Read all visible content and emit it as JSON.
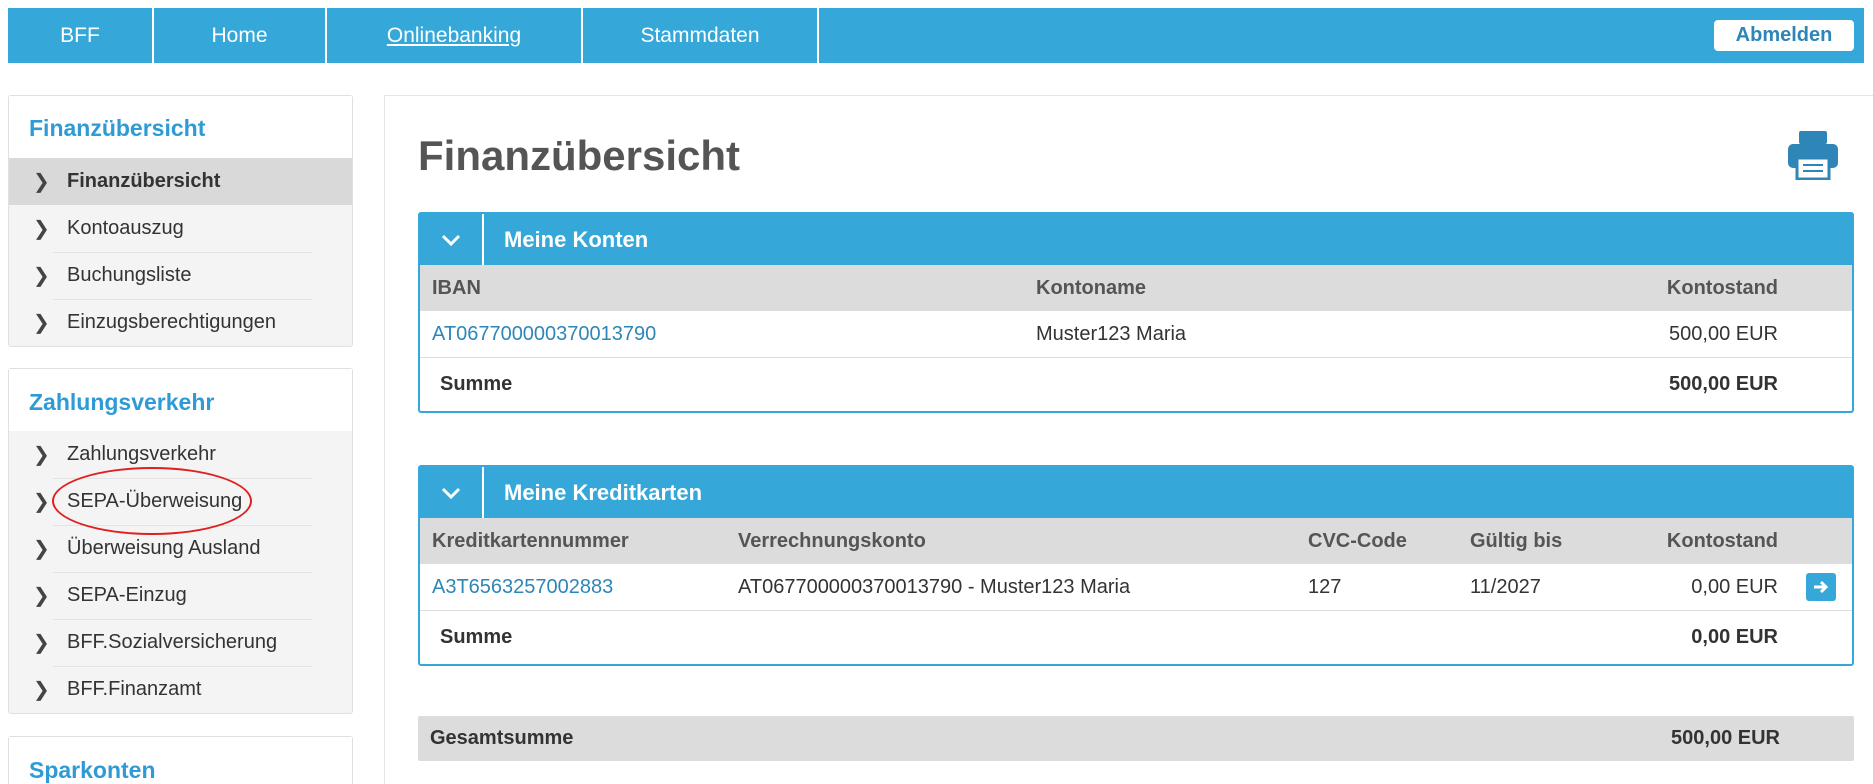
{
  "nav": {
    "items": [
      "BFF",
      "Home",
      "Onlinebanking",
      "Stammdaten"
    ],
    "logout_label": "Abmelden"
  },
  "sidebar": {
    "sections": [
      {
        "title": "Finanzübersicht",
        "items": [
          "Finanzübersicht",
          "Kontoauszug",
          "Buchungsliste",
          "Einzugsberechtigungen"
        ],
        "active_index": 0
      },
      {
        "title": "Zahlungsverkehr",
        "items": [
          "Zahlungsverkehr",
          "SEPA-Überweisung",
          "Überweisung Ausland",
          "SEPA-Einzug",
          "BFF.Sozialversicherung",
          "BFF.Finanzamt"
        ],
        "highlighted_index": 1
      },
      {
        "title": "Sparkonten",
        "items": []
      }
    ]
  },
  "main": {
    "title": "Finanzübersicht",
    "accounts": {
      "title": "Meine Konten",
      "headers": [
        "IBAN",
        "Kontoname",
        "Kontostand"
      ],
      "rows": [
        {
          "iban": "AT067700000370013790",
          "name": "Muster123 Maria",
          "balance": "500,00 EUR"
        }
      ],
      "sum_label": "Summe",
      "sum_value": "500,00 EUR"
    },
    "cards": {
      "title": "Meine Kreditkarten",
      "headers": [
        "Kreditkartennummer",
        "Verrechnungskonto",
        "CVC-Code",
        "Gültig bis",
        "Kontostand"
      ],
      "rows": [
        {
          "number": "A3T6563257002883",
          "account": "AT067700000370013790 - Muster123 Maria",
          "cvc": "127",
          "valid": "11/2027",
          "balance": "0,00 EUR"
        }
      ],
      "sum_label": "Summe",
      "sum_value": "0,00 EUR"
    },
    "grand_total_label": "Gesamtsumme",
    "grand_total_value": "500,00 EUR"
  },
  "colors": {
    "brand_blue": "#35a8d9",
    "link_blue": "#2e86b8",
    "annotation_red": "#e02020"
  }
}
